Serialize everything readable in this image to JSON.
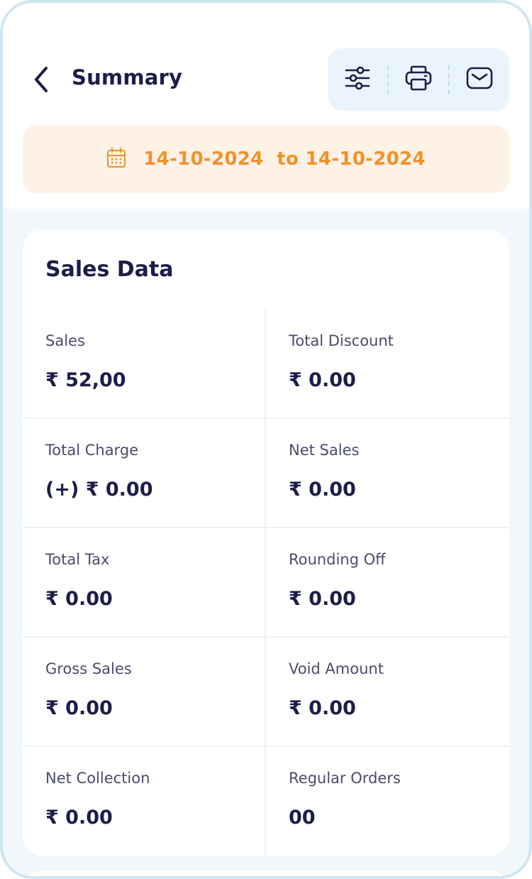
{
  "header": {
    "title": "Summary",
    "back_icon": "chevron-left-icon",
    "actions": [
      {
        "name": "filter-button",
        "icon": "sliders-icon"
      },
      {
        "name": "print-button",
        "icon": "printer-icon"
      },
      {
        "name": "email-button",
        "icon": "mail-icon"
      }
    ]
  },
  "date_range": {
    "icon": "calendar-icon",
    "text": "14-10-2024  to 14-10-2024"
  },
  "sales_data": {
    "title": "Sales Data",
    "items": [
      {
        "label": "Sales",
        "value": "₹ 52,00"
      },
      {
        "label": "Total Discount",
        "value": "₹ 0.00"
      },
      {
        "label": "Total Charge",
        "value": "(+) ₹ 0.00"
      },
      {
        "label": "Net Sales",
        "value": "₹ 0.00"
      },
      {
        "label": "Total Tax",
        "value": "₹ 0.00"
      },
      {
        "label": "Rounding Off",
        "value": "₹ 0.00"
      },
      {
        "label": "Gross Sales",
        "value": "₹ 0.00"
      },
      {
        "label": "Void Amount",
        "value": "₹ 0.00"
      },
      {
        "label": "Net Collection",
        "value": "₹ 0.00"
      },
      {
        "label": "Regular Orders",
        "value": "00"
      }
    ]
  },
  "colors": {
    "primary_text": "#1c1d48",
    "accent_orange": "#f0922a",
    "date_bg": "#fdf2e5",
    "action_bg": "#eaf4fc",
    "page_bg": "#f1f7fa"
  }
}
